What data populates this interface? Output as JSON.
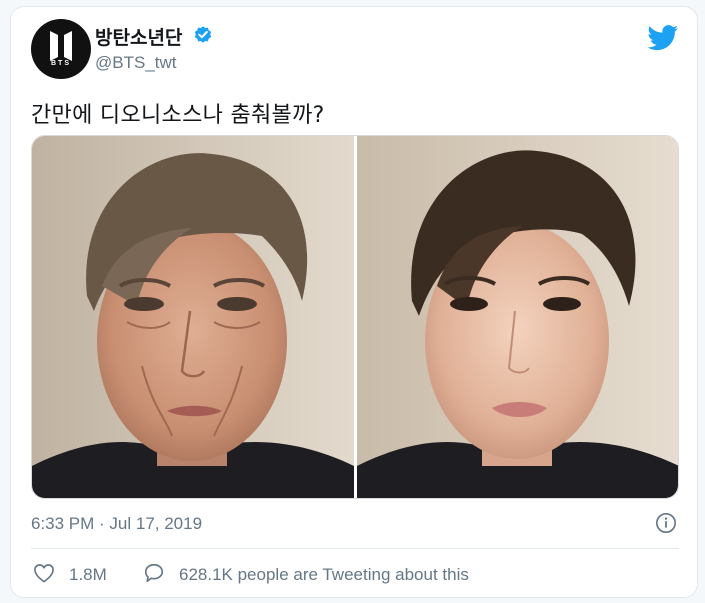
{
  "author": {
    "display_name": "방탄소년단",
    "handle": "@BTS_twt",
    "avatar_text": "BTS",
    "verified": true
  },
  "tweet": {
    "text": "간만에 디오니소스나 춤춰볼까?",
    "timestamp": "6:33 PM · Jul 17, 2019"
  },
  "stats": {
    "likes": "1.8M",
    "conversation": "628.1K people are Tweeting about this"
  },
  "colors": {
    "twitter_blue": "#1da1f2",
    "text_secondary": "#657786",
    "border": "#e1e8ed"
  },
  "icons": [
    "twitter-bird-icon",
    "verified-badge-icon",
    "info-icon",
    "heart-icon",
    "speech-bubble-icon"
  ]
}
